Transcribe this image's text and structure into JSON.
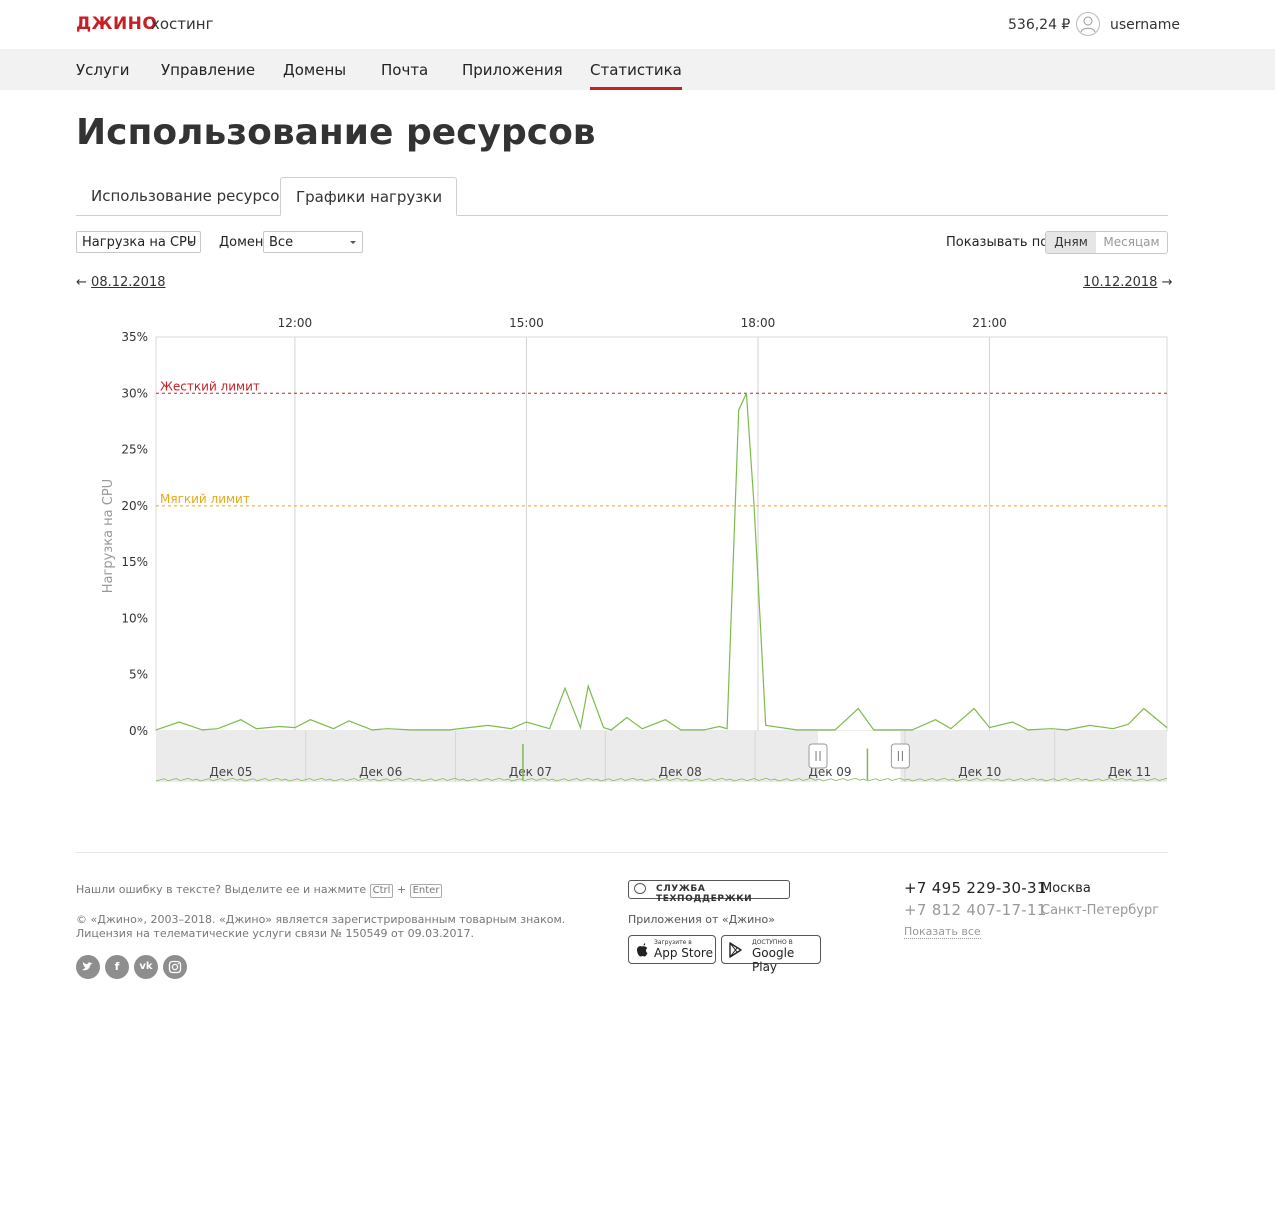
{
  "header": {
    "logo": "ДЖИНО",
    "logo_sub": "хостинг",
    "balance": "536,24 ₽",
    "username": "username"
  },
  "nav": {
    "items": [
      "Услуги",
      "Управление",
      "Домены",
      "Почта",
      "Приложения",
      "Статистика"
    ],
    "active": "Статистика"
  },
  "page": {
    "title": "Использование ресурсов",
    "tabs": [
      "Использование ресурсов",
      "Графики нагрузки"
    ],
    "active_tab": "Графики нагрузки"
  },
  "controls": {
    "metric_select": "Нагрузка на CPU",
    "domain_label": "Домен",
    "domain_select": "Все",
    "show_by_label": "Показывать по",
    "period_options": [
      "Дням",
      "Месяцам"
    ],
    "period_selected": "Дням",
    "prev_date": "08.12.2018",
    "next_date": "10.12.2018",
    "prev_arrow": "←",
    "next_arrow": "→"
  },
  "chart_data": {
    "type": "line",
    "ylabel": "Нагрузка на CPU",
    "ylim": [
      0,
      35
    ],
    "yticks": [
      "35%",
      "30%",
      "25%",
      "20%",
      "15%",
      "10%",
      "5%",
      "0%"
    ],
    "xticks": [
      "12:00",
      "15:00",
      "18:00",
      "21:00"
    ],
    "x_range_hours": [
      10.2,
      23.3
    ],
    "grid": true,
    "hard_limit": {
      "label": "Жесткий лимит",
      "value": 30,
      "color": "#c62026"
    },
    "soft_limit": {
      "label": "Мягкий лимит",
      "value": 20,
      "color": "#e5a91a"
    },
    "series": [
      {
        "color": "#7dbb4e",
        "x": [
          10.2,
          10.5,
          10.8,
          11.0,
          11.3,
          11.5,
          11.8,
          12.0,
          12.2,
          12.5,
          12.7,
          13.0,
          13.2,
          13.5,
          14.0,
          14.5,
          14.8,
          15.0,
          15.3,
          15.5,
          15.7,
          15.8,
          16.0,
          16.1,
          16.3,
          16.5,
          16.8,
          17.0,
          17.3,
          17.5,
          17.6,
          17.75,
          17.85,
          17.95,
          18.1,
          18.5,
          19.0,
          19.3,
          19.5,
          20.0,
          20.3,
          20.5,
          20.8,
          21.0,
          21.3,
          21.5,
          21.8,
          22.0,
          22.3,
          22.6,
          22.8,
          23.0,
          23.3
        ],
        "y": [
          0.1,
          0.8,
          0.1,
          0.2,
          1.0,
          0.2,
          0.4,
          0.3,
          1.0,
          0.2,
          0.9,
          0.1,
          0.2,
          0.1,
          0.1,
          0.5,
          0.2,
          0.8,
          0.2,
          3.8,
          0.3,
          4.0,
          0.3,
          0.1,
          1.2,
          0.2,
          1.0,
          0.1,
          0.1,
          0.4,
          0.2,
          28.5,
          30.0,
          20.0,
          0.5,
          0.1,
          0.1,
          2.0,
          0.1,
          0.1,
          1.0,
          0.2,
          2.0,
          0.3,
          0.8,
          0.1,
          0.2,
          0.1,
          0.5,
          0.2,
          0.6,
          2.0,
          0.3
        ]
      }
    ],
    "navigator": {
      "labels": [
        "Дек 05",
        "Дек 06",
        "Дек 07",
        "Дек 08",
        "Дек 09",
        "Дек 10",
        "Дек 11"
      ],
      "spikes": [
        {
          "day": 2.45,
          "value": 0.8
        },
        {
          "day": 4.75,
          "value": 0.7
        }
      ],
      "selection_start_day": 4.42,
      "selection_end_day": 4.97
    }
  },
  "footer": {
    "typo_text": "Нашли ошибку в тексте? Выделите ее и нажмите",
    "key1": "Ctrl",
    "plus": "+",
    "key2": "Enter",
    "copyright": "© «Джино», 2003–2018. «Джино» является зарегистрированным товарным знаком.",
    "license": "Лицензия на телематические услуги связи № 150549 от 09.03.2017.",
    "support": "СЛУЖБА ТЕХПОДДЕРЖКИ",
    "apps_label": "Приложения от «Джино»",
    "appstore_small": "Загрузите в",
    "appstore": "App Store",
    "gplay_small": "ДОСТУПНО В",
    "gplay": "Google Play",
    "phone1": "+7 495 229-30-31",
    "city1": "Москва",
    "phone2": "+7 812 407-17-11",
    "city2": "Санкт-Петербург",
    "show_all": "Показать все"
  }
}
